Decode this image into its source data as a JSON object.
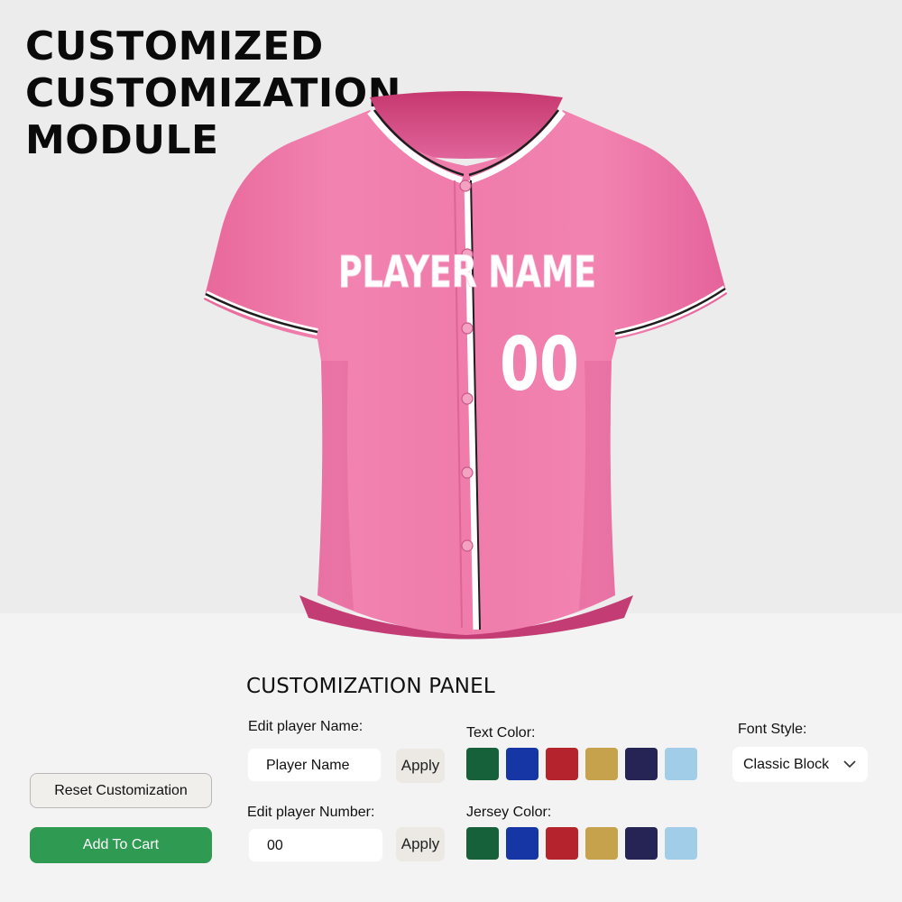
{
  "title_lines": [
    "CUSTOMIZED",
    "CUSTOMIZATION",
    "MODULE"
  ],
  "jersey": {
    "name_text": "PLAYER NAME",
    "number_text": "00",
    "body_color": "#ee7aa8",
    "trim_color": "#1e1e1e",
    "lettering_color": "#ffffff"
  },
  "panel": {
    "title": "CUSTOMIZATION PANEL",
    "name_label": "Edit player Name:",
    "name_value": "Player Name",
    "number_label": "Edit player Number:",
    "number_value": "00",
    "apply_label": "Apply",
    "text_color_label": "Text Color:",
    "jersey_color_label": "Jersey Color:",
    "font_style_label": "Font Style:",
    "font_style_value": "Classic Block",
    "swatch_colors": [
      "#17613a",
      "#1736a6",
      "#b5242c",
      "#c6a24c",
      "#262355",
      "#a2cde8"
    ]
  },
  "actions": {
    "reset_label": "Reset Customization",
    "cart_label": "Add To Cart"
  },
  "colors": {
    "accent_green": "#2f9a52"
  }
}
